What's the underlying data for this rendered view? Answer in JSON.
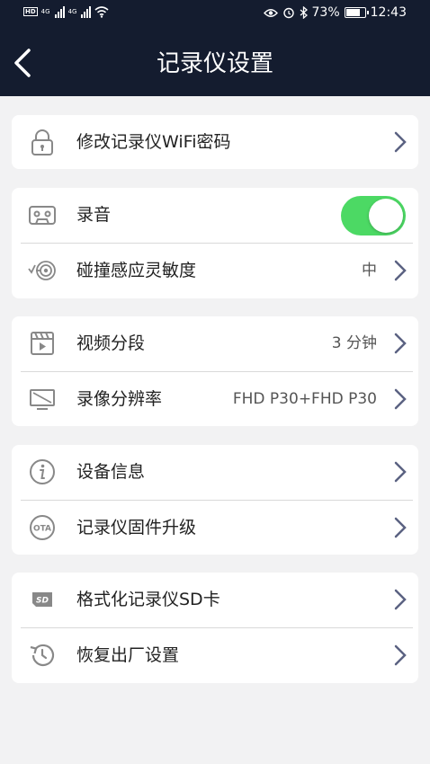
{
  "status_bar": {
    "network_left": "4G",
    "network_right": "4G",
    "hd_label": "HD",
    "battery": "73%",
    "time": "12:43"
  },
  "header": {
    "title": "记录仪设置"
  },
  "groups": [
    {
      "rows": [
        {
          "label": "修改记录仪WiFi密码",
          "icon": "lock-icon"
        }
      ]
    },
    {
      "rows": [
        {
          "label": "录音",
          "icon": "cassette-icon",
          "toggle_on": true
        },
        {
          "label": "碰撞感应灵敏度",
          "value": "中",
          "icon": "collision-sensor-icon"
        }
      ]
    },
    {
      "rows": [
        {
          "label": "视频分段",
          "value": "3 分钟",
          "icon": "clapperboard-icon"
        },
        {
          "label": "录像分辨率",
          "value": "FHD P30+FHD P30",
          "icon": "screen-resolution-icon"
        }
      ]
    },
    {
      "rows": [
        {
          "label": "设备信息",
          "icon": "info-icon"
        },
        {
          "label": "记录仪固件升级",
          "icon": "ota-icon"
        }
      ]
    },
    {
      "rows": [
        {
          "label": "格式化记录仪SD卡",
          "icon": "sd-card-icon"
        },
        {
          "label": "恢复出厂设置",
          "icon": "restore-history-icon"
        }
      ]
    }
  ],
  "colors": {
    "header_bg": "#141c2f",
    "toggle_on": "#4cd964",
    "chevron": "#5b6282"
  }
}
